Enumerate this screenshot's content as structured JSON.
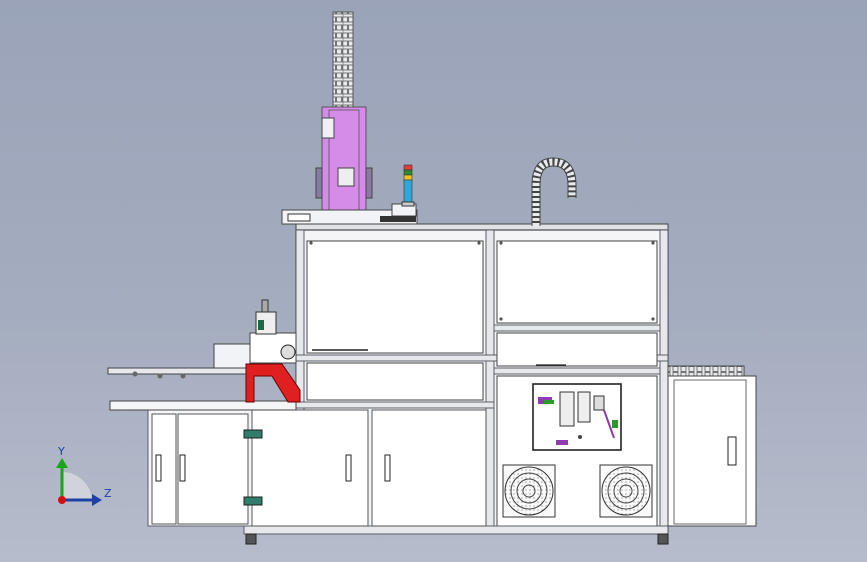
{
  "viewport": {
    "background_top": "#9aa3b8",
    "background_bottom": "#b6bccb"
  },
  "colors": {
    "frame": "#f4f5f7",
    "frame_edge": "#6b6f78",
    "panel": "#ffffff",
    "accent_magenta": "#d58be8",
    "accent_red": "#e02020",
    "axis_y": "#1aa51a",
    "axis_z": "#1f3fa8",
    "axis_x": "#d01010"
  },
  "triad": {
    "y_label": "Y",
    "z_label": "Z"
  },
  "signal_tower": {
    "lights": [
      "#e23b3b",
      "#2b8f2b",
      "#f0c020",
      "#2fa8d8"
    ]
  }
}
